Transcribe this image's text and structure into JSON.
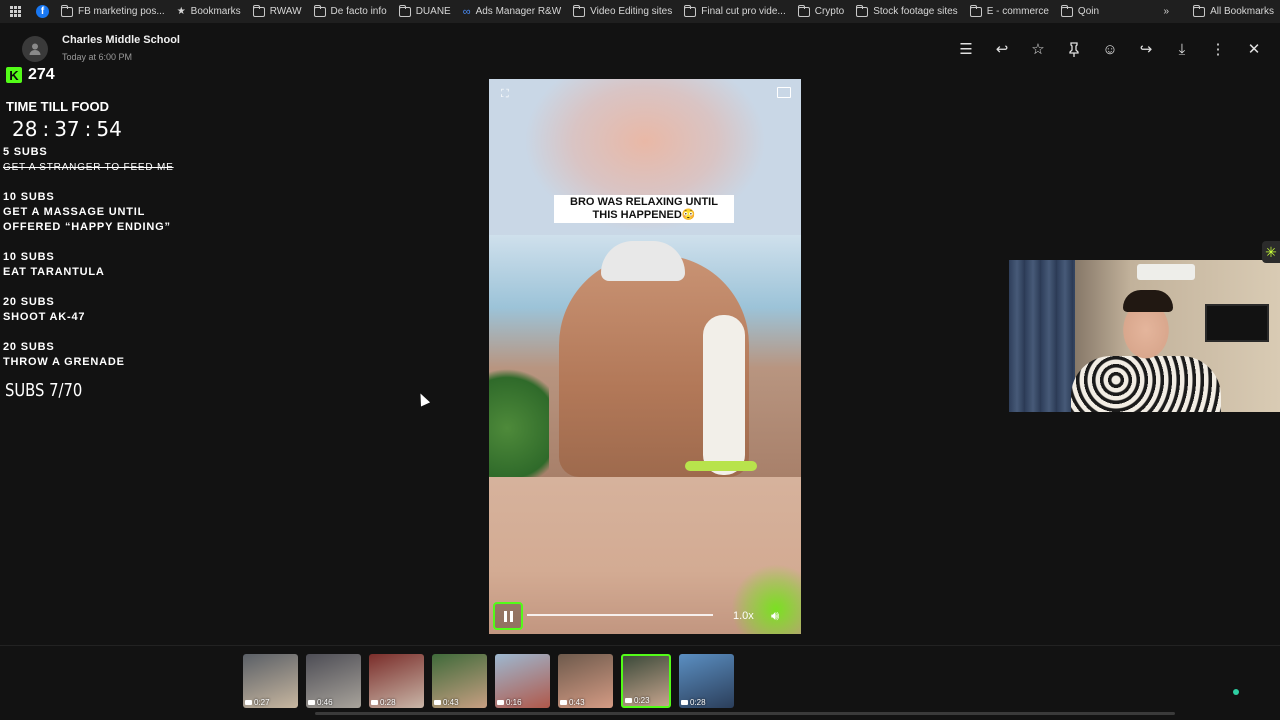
{
  "bookmarks": {
    "items": [
      {
        "label": "FB marketing pos...",
        "icon": "facebook-icon"
      },
      {
        "label": "Bookmarks",
        "icon": "star-icon"
      },
      {
        "label": "RWAW",
        "icon": "folder-icon"
      },
      {
        "label": "De facto info",
        "icon": "folder-icon"
      },
      {
        "label": "DUANE",
        "icon": "folder-icon"
      },
      {
        "label": "Ads Manager R&W",
        "icon": "meta-icon"
      },
      {
        "label": "Video Editing sites",
        "icon": "folder-icon"
      },
      {
        "label": "Final cut pro vide...",
        "icon": "folder-icon"
      },
      {
        "label": "Crypto",
        "icon": "folder-icon"
      },
      {
        "label": "Stock footage sites",
        "icon": "folder-icon"
      },
      {
        "label": "E - commerce",
        "icon": "folder-icon"
      },
      {
        "label": "Qoin",
        "icon": "folder-icon"
      }
    ],
    "overflow": "»",
    "all_bookmarks": "All Bookmarks"
  },
  "message": {
    "sender": "Charles Middle School",
    "time": "Today at 6:00 PM"
  },
  "toolbar": {
    "icons": [
      "caption-icon",
      "reply-icon",
      "star-icon",
      "pin-icon",
      "emoji-icon",
      "forward-icon",
      "download-icon",
      "more-icon",
      "close-icon"
    ],
    "glyphs": [
      "☰",
      "↩",
      "☆",
      "📌",
      "☺",
      "↪",
      "⤓",
      "⋮",
      "✕"
    ]
  },
  "overlay": {
    "kick_logo": "K",
    "kick_count": "274",
    "timer_label": "TIME TILL FOOD",
    "timer": {
      "h": "28",
      "m": "37",
      "s": "54"
    },
    "timer_sep": ":",
    "goals": [
      {
        "subs": "5 SUBS",
        "text": "GET A STRANGER TO FEED ME",
        "completed": true
      },
      {
        "subs": "10 SUBS",
        "text": "GET A MASSAGE UNTIL",
        "text2": "OFFERED “HAPPY ENDING”",
        "completed": false
      },
      {
        "subs": "10 SUBS",
        "text": "EAT TARANTULA",
        "completed": false
      },
      {
        "subs": "20 SUBS",
        "text": "SHOOT AK-47",
        "completed": false
      },
      {
        "subs": "20 SUBS",
        "text": "THROW A GRENADE",
        "completed": false
      }
    ],
    "subs_count": "SUBS 7/70"
  },
  "video": {
    "caption_line1": "BRO WAS RELAXING UNTIL",
    "caption_line2": "THIS HAPPENED😳",
    "speed": "1.0x",
    "progress": 0.0
  },
  "thumbnails": [
    {
      "duration": "0:27",
      "colors": [
        "#5a5f66",
        "#c8b7a0"
      ]
    },
    {
      "duration": "0:46",
      "colors": [
        "#4d4d55",
        "#a8a39b"
      ]
    },
    {
      "duration": "0:28",
      "colors": [
        "#7a2d2a",
        "#c9b6a8"
      ]
    },
    {
      "duration": "0:43",
      "colors": [
        "#3f6a3a",
        "#c79f82"
      ]
    },
    {
      "duration": "0:16",
      "colors": [
        "#9db8d0",
        "#b0584a"
      ]
    },
    {
      "duration": "0:43",
      "colors": [
        "#6e5a4c",
        "#d49b84"
      ]
    },
    {
      "duration": "0:23",
      "colors": [
        "#3c4a3a",
        "#c5a48d"
      ],
      "active": true
    },
    {
      "duration": "0:28",
      "colors": [
        "#5b8fc2",
        "#2b3e5a"
      ]
    }
  ],
  "colors": {
    "accent": "#53fc18",
    "background": "#121212"
  }
}
